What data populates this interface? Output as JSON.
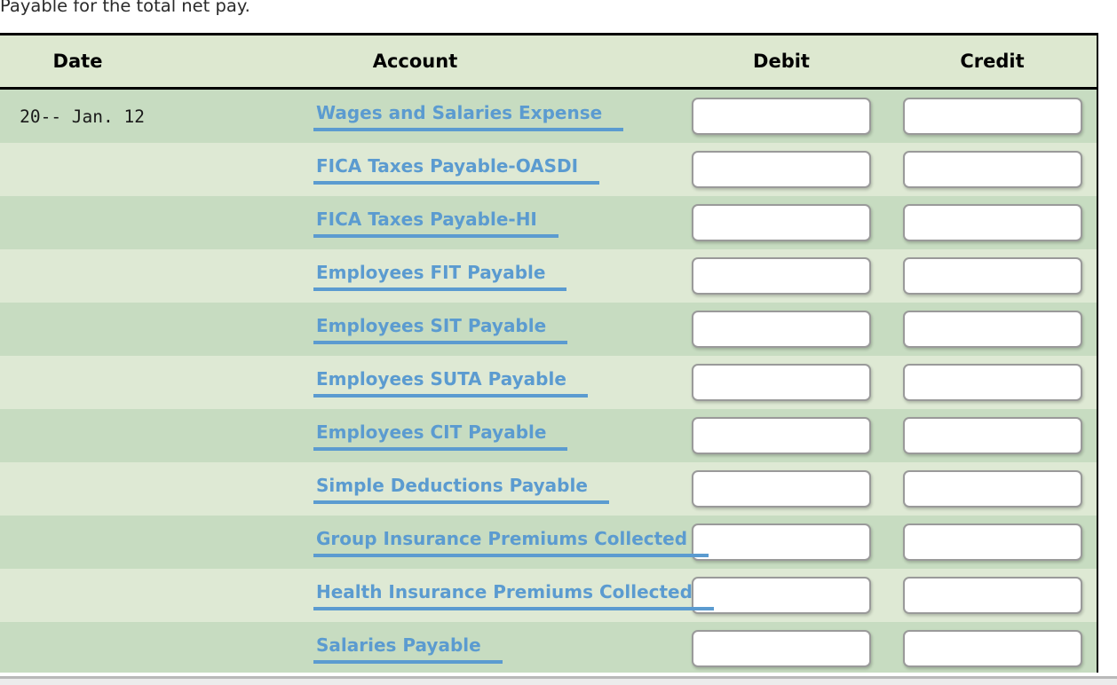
{
  "intro": {
    "text": "Payable for the total net pay."
  },
  "table": {
    "headers": {
      "date": "Date",
      "account": "Account",
      "debit": "Debit",
      "credit": "Credit"
    },
    "accent_color": "#5b9bd0",
    "row_color_odd": "#c7dcc1",
    "row_color_even": "#dee9d4",
    "header_color": "#dde8d0",
    "rows": [
      {
        "date": "20-- Jan. 12",
        "account": "Wages and Salaries Expense",
        "debit": "",
        "credit": ""
      },
      {
        "date": "",
        "account": "FICA Taxes Payable-OASDI",
        "debit": "",
        "credit": ""
      },
      {
        "date": "",
        "account": "FICA Taxes Payable-HI",
        "debit": "",
        "credit": ""
      },
      {
        "date": "",
        "account": "Employees FIT Payable",
        "debit": "",
        "credit": ""
      },
      {
        "date": "",
        "account": "Employees SIT Payable",
        "debit": "",
        "credit": ""
      },
      {
        "date": "",
        "account": "Employees SUTA Payable",
        "debit": "",
        "credit": ""
      },
      {
        "date": "",
        "account": "Employees CIT Payable",
        "debit": "",
        "credit": ""
      },
      {
        "date": "",
        "account": "Simple Deductions Payable",
        "debit": "",
        "credit": ""
      },
      {
        "date": "",
        "account": "Group Insurance Premiums Collected",
        "debit": "",
        "credit": ""
      },
      {
        "date": "",
        "account": "Health Insurance Premiums Collected",
        "debit": "",
        "credit": ""
      },
      {
        "date": "",
        "account": "Salaries Payable",
        "debit": "",
        "credit": ""
      }
    ]
  }
}
